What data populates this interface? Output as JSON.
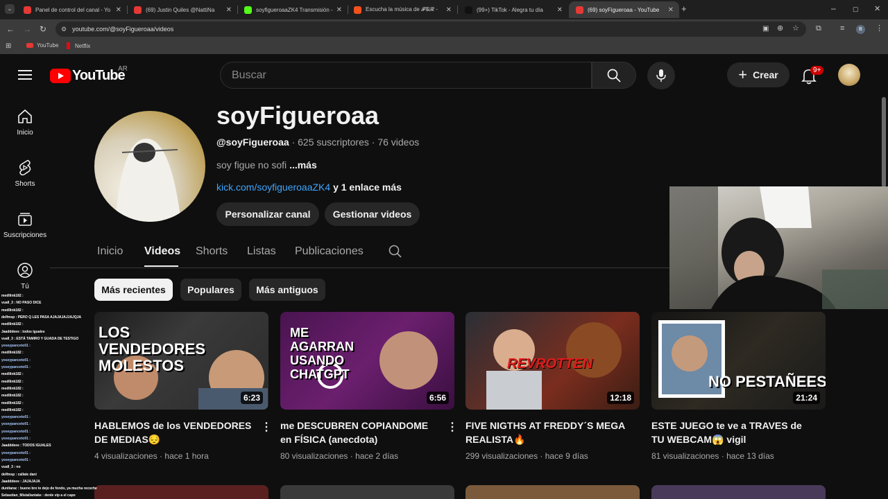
{
  "browser": {
    "tabs": [
      {
        "title": "Panel de control del canal - Yo",
        "favicon_color": "#e53935"
      },
      {
        "title": "(69) Justin Quiles @NattiNa",
        "favicon_color": "#e53935"
      },
      {
        "title": "soyfigueroaaZK4 Transmisión -",
        "favicon_color": "#53fc18"
      },
      {
        "title": "Escucha la música de 𝓕𝓖𝓡 -",
        "favicon_color": "#f4511e"
      },
      {
        "title": "(99+) TikTok - Alegra tu día",
        "favicon_color": "#111111"
      },
      {
        "title": "(69) soyFigueroaa - YouTube",
        "favicon_color": "#e53935"
      }
    ],
    "active_tab_index": 5,
    "url": "youtube.com/@soyFigueroaa/videos",
    "bookmarks": [
      "YouTube",
      "Netflix"
    ],
    "profile_letter": "B"
  },
  "yt": {
    "logo_text": "YouTube",
    "country": "AR",
    "search_placeholder": "Buscar",
    "create_label": "Crear",
    "notif_badge": "9+",
    "nav": [
      {
        "label": "Inicio",
        "icon": "home-icon"
      },
      {
        "label": "Shorts",
        "icon": "shorts-icon"
      },
      {
        "label": "Suscripciones",
        "icon": "subscriptions-icon"
      },
      {
        "label": "Tú",
        "icon": "you-icon"
      }
    ]
  },
  "channel": {
    "name": "soyFigueroaa",
    "handle": "@soyFigueroaa",
    "subscribers": "625 suscriptores",
    "videos_count": "76 videos",
    "dot": "·",
    "description": "soy figue no sofi",
    "more": "...más",
    "link": "kick.com/soyfigueroaaZK4",
    "link_more": "y 1 enlace más",
    "customize_label": "Personalizar canal",
    "manage_label": "Gestionar videos",
    "tabs": [
      "Inicio",
      "Videos",
      "Shorts",
      "Listas",
      "Publicaciones"
    ],
    "selected_tab": "Videos",
    "chips": [
      "Más recientes",
      "Populares",
      "Más antiguos"
    ],
    "selected_chip": "Más recientes"
  },
  "videos": [
    {
      "title": "HABLEMOS de los VENDEDORES DE MEDIAS😔",
      "duration": "6:23",
      "views": "4 visualizaciones",
      "age": "hace 1 hora",
      "thumb_text": "LOS VENDEDORES MOLESTOS"
    },
    {
      "title": "me DESCUBREN COPIANDOME en FÍSICA (anecdota)",
      "duration": "6:56",
      "views": "80 visualizaciones",
      "age": "hace 2 días",
      "thumb_text": "ME AGARRAN USANDO CHATGPT"
    },
    {
      "title": "FIVE NIGTHS AT FREDDY´S MEGA REALISTA🔥",
      "duration": "12:18",
      "views": "299 visualizaciones",
      "age": "hace 9 días",
      "thumb_text": "REVROTTEN"
    },
    {
      "title": "ESTE JUEGO te ve a TRAVES de TU WEBCAM😱 vigil",
      "duration": "21:24",
      "views": "81 visualizaciones",
      "age": "hace 13 días",
      "thumb_text": "NO PESTAÑEES"
    }
  ],
  "chat": [
    "medllink182 :",
    "vuall_3 : NO PASO DICE",
    "medllink182 :",
    "delfmsp : PERO Q LES PASA AJAJAJAJJAJQJA",
    "medllink182 :",
    "Jaadddeee : todos iguales",
    "vuall_3 : ESTÁ TAMIRO Y GUADA DE TESTIGO",
    "yoseypanceto01 :",
    "medllink182 :",
    "yoseypanceto01 :",
    "yoseypanceto01 :",
    "medllink182 :",
    "medllink182 :",
    "medllink182 :",
    "medllink182 :",
    "medllink182 :",
    "medllink182 :",
    "yoseypanceto01 :",
    "yoseypanceto01 :",
    "yoseypanceto01 :",
    "yoseypanceto01 :",
    "Jaadddeee : TODOS IGUALES",
    "yoseypanceto01 :",
    "yoseypanceto01 :",
    "vuall_3 : no",
    "delfmsp : callate dani",
    "Jaadddeee : JAJAJAJA",
    "dunitarac : bueno bro te dejo de fondo, ya mucha recoche",
    "Sebastian_Mistal/antake : denle vip a el capo"
  ],
  "colors": {
    "accent": "#3ea6ff",
    "brand": "#ff0000",
    "bg": "#0f0f0f"
  }
}
